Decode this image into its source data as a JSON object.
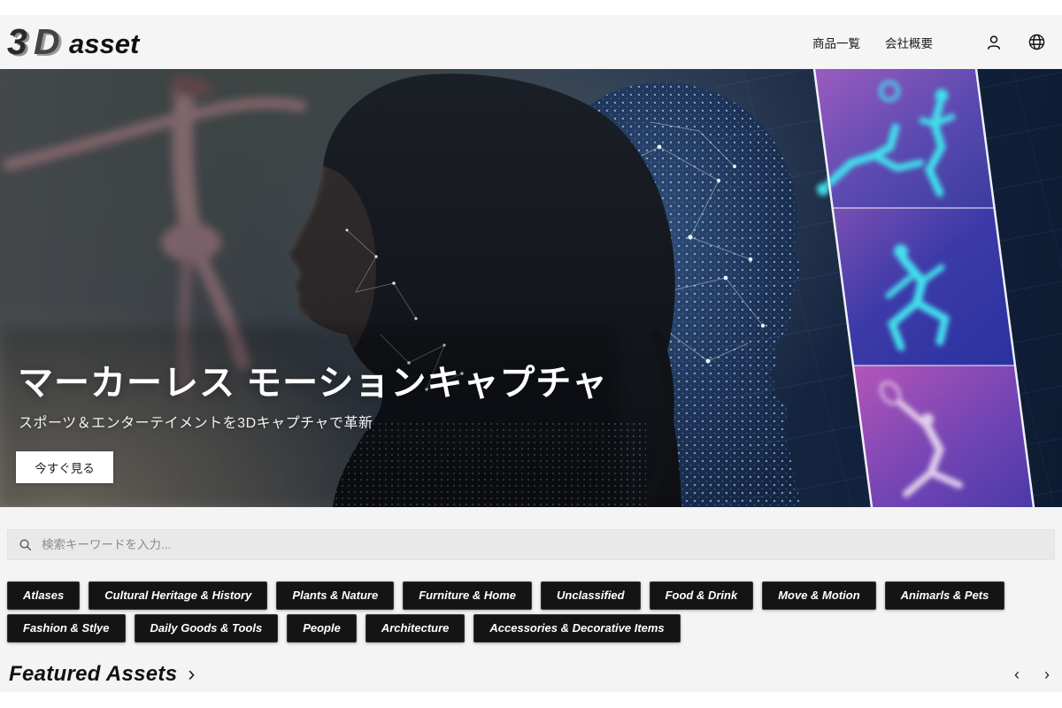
{
  "brand": {
    "mark": "3D",
    "name": "asset"
  },
  "header": {
    "nav": [
      {
        "label": "商品一覧"
      },
      {
        "label": "会社概要"
      }
    ]
  },
  "hero": {
    "title": "マーカーレス モーションキャプチャ",
    "subtitle": "スポーツ＆エンターテイメントを3Dキャプチャで革新",
    "cta_label": "今すぐ見る"
  },
  "search": {
    "placeholder": "検索キーワードを入力..."
  },
  "categories": [
    "Atlases",
    "Cultural Heritage & History",
    "Plants & Nature",
    "Furniture & Home",
    "Unclassified",
    "Food & Drink",
    "Move & Motion",
    "Animarls & Pets",
    "Fashion & Stlye",
    "Daily Goods & Tools",
    "People",
    "Architecture",
    "Accessories & Decorative Items"
  ],
  "featured": {
    "title": "Featured Assets",
    "forward_icon": "›",
    "prev_icon": "‹",
    "next_icon": "›"
  },
  "colors": {
    "header_bg": "#f5f5f6",
    "section_bg": "#f4f4f5",
    "chip_bg": "#141414",
    "accent_cyan": "#3fe6f0",
    "strip_purple": "#8a56b8",
    "hero_navy": "#0d1b32"
  }
}
